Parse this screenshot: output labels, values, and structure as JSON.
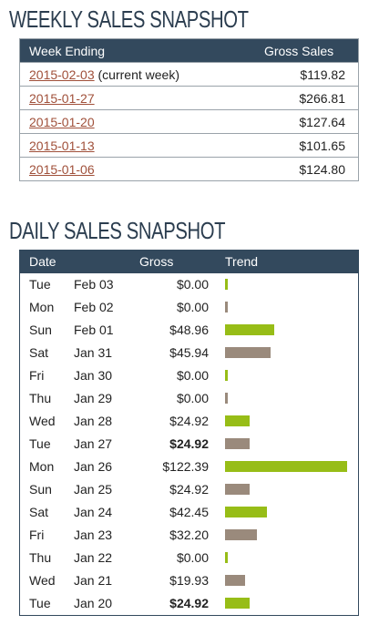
{
  "weekly": {
    "title": "WEEKLY SALES SNAPSHOT",
    "headers": {
      "week": "Week Ending",
      "gross": "Gross Sales"
    },
    "rows": [
      {
        "date": "2015-02-03",
        "note": "(current week)",
        "gross": "$119.82"
      },
      {
        "date": "2015-01-27",
        "note": "",
        "gross": "$266.81"
      },
      {
        "date": "2015-01-20",
        "note": "",
        "gross": "$127.64"
      },
      {
        "date": "2015-01-13",
        "note": "",
        "gross": "$101.65"
      },
      {
        "date": "2015-01-06",
        "note": "",
        "gross": "$124.80"
      }
    ]
  },
  "daily": {
    "title": "DAILY SALES SNAPSHOT",
    "headers": {
      "date": "Date",
      "gross": "Gross",
      "trend": "Trend"
    },
    "colors": {
      "green": "#97bd17",
      "brown": "#9a8a7c"
    },
    "rows": [
      {
        "day": "Tue",
        "date": "Feb 03",
        "gross": "$0.00",
        "value": 0.0,
        "bold": false,
        "color": "green"
      },
      {
        "day": "Mon",
        "date": "Feb 02",
        "gross": "$0.00",
        "value": 0.0,
        "bold": false,
        "color": "brown"
      },
      {
        "day": "Sun",
        "date": "Feb 01",
        "gross": "$48.96",
        "value": 48.96,
        "bold": false,
        "color": "green"
      },
      {
        "day": "Sat",
        "date": "Jan 31",
        "gross": "$45.94",
        "value": 45.94,
        "bold": false,
        "color": "brown"
      },
      {
        "day": "Fri",
        "date": "Jan 30",
        "gross": "$0.00",
        "value": 0.0,
        "bold": false,
        "color": "green"
      },
      {
        "day": "Thu",
        "date": "Jan 29",
        "gross": "$0.00",
        "value": 0.0,
        "bold": false,
        "color": "brown"
      },
      {
        "day": "Wed",
        "date": "Jan 28",
        "gross": "$24.92",
        "value": 24.92,
        "bold": false,
        "color": "green"
      },
      {
        "day": "Tue",
        "date": "Jan 27",
        "gross": "$24.92",
        "value": 24.92,
        "bold": true,
        "color": "brown"
      },
      {
        "day": "Mon",
        "date": "Jan 26",
        "gross": "$122.39",
        "value": 122.39,
        "bold": false,
        "color": "green"
      },
      {
        "day": "Sun",
        "date": "Jan 25",
        "gross": "$24.92",
        "value": 24.92,
        "bold": false,
        "color": "brown"
      },
      {
        "day": "Sat",
        "date": "Jan 24",
        "gross": "$42.45",
        "value": 42.45,
        "bold": false,
        "color": "green"
      },
      {
        "day": "Fri",
        "date": "Jan 23",
        "gross": "$32.20",
        "value": 32.2,
        "bold": false,
        "color": "brown"
      },
      {
        "day": "Thu",
        "date": "Jan 22",
        "gross": "$0.00",
        "value": 0.0,
        "bold": false,
        "color": "green"
      },
      {
        "day": "Wed",
        "date": "Jan 21",
        "gross": "$19.93",
        "value": 19.93,
        "bold": false,
        "color": "brown"
      },
      {
        "day": "Tue",
        "date": "Jan 20",
        "gross": "$24.92",
        "value": 24.92,
        "bold": true,
        "color": "green"
      }
    ]
  }
}
